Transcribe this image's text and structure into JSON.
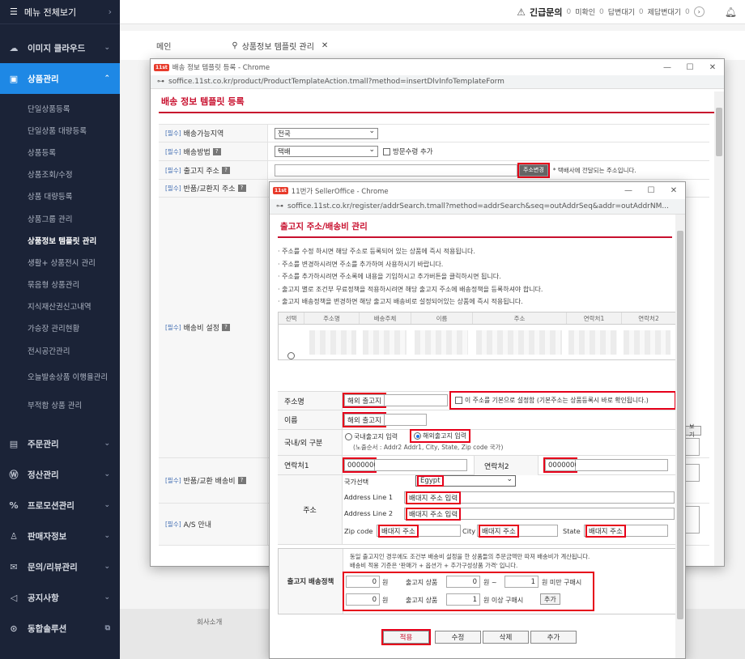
{
  "sidebar": {
    "top": "메뉴 전체보기",
    "items": [
      {
        "icon": "☁",
        "label": "이미지 클라우드"
      },
      {
        "icon": "▣",
        "label": "상품관리"
      }
    ],
    "subs": [
      "단일상품등록",
      "단일상품 대량등록",
      "상품등록",
      "상품조회/수정",
      "상품 대량등록",
      "상품그룹 관리",
      "상품정보 템플릿 관리",
      "생활+ 상품전시 관리",
      "묶음형 상품관리",
      "지식재산권신고내역",
      "가승장 관리현황",
      "전시공간관리",
      "오늘발송상품 이행율관리",
      "부적합 상품 관리"
    ],
    "items2": [
      {
        "icon": "▤",
        "label": "주문관리"
      },
      {
        "icon": "Ⓦ",
        "label": "정산관리"
      },
      {
        "icon": "%",
        "label": "프로모션관리"
      },
      {
        "icon": "♙",
        "label": "판매자정보"
      },
      {
        "icon": "✉",
        "label": "문의/리뷰관리"
      },
      {
        "icon": "◁",
        "label": "공지사항"
      },
      {
        "icon": "⊙",
        "label": "동합솔루션"
      }
    ]
  },
  "header": {
    "urgent": "긴급문의",
    "urgent_n": "0",
    "a": "미확인",
    "a_n": "0",
    "b": "답변대기",
    "b_n": "0",
    "c": "제답변대기",
    "c_n": "0"
  },
  "tabs": {
    "main": "메인",
    "template": "상품정보 템플릿 관리"
  },
  "footer": {
    "company": "회사소개"
  },
  "win1": {
    "title": "배송 정보 템플릿 등록 - Chrome",
    "url": "soffice.11st.co.kr/product/ProductTemplateAction.tmall?method=insertDlvInfoTemplateForm",
    "heading": "배송 정보 템플릿 등록",
    "req": "[필수]",
    "rows": {
      "area": "배송가능지역",
      "area_val": "전국",
      "method": "배송방법",
      "method_val": "택배",
      "visit": "방문수령 추가",
      "addr": "출고지 주소",
      "addr_btn": "주소변경",
      "addr_note": "* 택배사에 전달되는 주소입니다.",
      "ret": "반품/교환지 주소",
      "fee": "배송비 설정",
      "retfee": "반품/교환 배송비",
      "as": "A/S 안내",
      "side": "보기"
    }
  },
  "win2": {
    "title": "11번가 SellerOffice - Chrome",
    "url": "soffice.11st.co.kr/register/addrSearch.tmall?method=addrSearch&seq=outAddrSeq&addr=outAddrNM...",
    "heading": "출고지 주소/배송비 관리",
    "notes": [
      "· 주소를 수정 하시면 해당 주소로 등록되어 있는 상품에 즉시 적용됩니다.",
      "· 주소를 변경하시려면 주소를 추가하여 사용하시기 바랍니다.",
      "· 주소를 추가하시려면 주소록에 내용을 기입하시고 추가버튼을 클릭하시면 됩니다.",
      "· 출고지 별로 조건부 무료정책을 적용하시려면 해당 출고지 주소에 배송정책을 등록하셔야 합니다.",
      "· 출고지 배송정책을 변경하면 해당 출고지 배송비로 설정되어있는 상품에 즉시 적용됩니다."
    ],
    "cols": [
      "선택",
      "주소명",
      "배송주체",
      "이름",
      "주소",
      "연락처1",
      "연락처2"
    ],
    "form": {
      "name_lbl": "주소명",
      "name_val": "해외 출고지",
      "default_lbl": "이 주소를 기본으로 설정함 (기본주소는 상품등록시 바로 확인됩니다.)",
      "person_lbl": "이름",
      "person_val": "해외 출고지",
      "type_lbl": "국내/외 구분",
      "dom": "국내출고지 입력",
      "intl": "해외출고지 입력",
      "order_note": "(노출순서 : Addr2 Addr1, City, State, Zip code 국가)",
      "tel1_lbl": "연락처1",
      "tel1": "0000000",
      "tel2_lbl": "연락처2",
      "tel2": "0000000",
      "addr_lbl": "주소",
      "country_lbl": "국가선택",
      "country": "Egypt",
      "l1_lbl": "Address Line 1",
      "l1": "배대지 주소 입력",
      "l2_lbl": "Address Line 2",
      "l2": "배대지 주소 입력",
      "zip_lbl": "Zip code",
      "zip": "배대지 주소",
      "city_lbl": "City",
      "city": "배대지 주소",
      "state_lbl": "State",
      "state": "배대지 주소",
      "policy_note1": "동일 출고지인 경우에도 조건부 배송비 설정을 한 상품들의 주문금액만 따져 배송비가 계산됩니다.",
      "policy_note2": "배송비 적용 기준은 '판매가 + 옵션가 + 추가구성상품 가격' 입니다.",
      "policy_lbl": "출고지 배송정책",
      "p1": "0",
      "won": "원",
      "cond": "출고지 상품",
      "p2": "0",
      "dash": "원 ~",
      "p3": "1",
      "under": "원 미만 구매시",
      "p4": "0",
      "p5": "1",
      "over": "원 이상 구매시",
      "add": "추가"
    },
    "buttons": [
      "적용",
      "수정",
      "삭제",
      "추가"
    ]
  }
}
